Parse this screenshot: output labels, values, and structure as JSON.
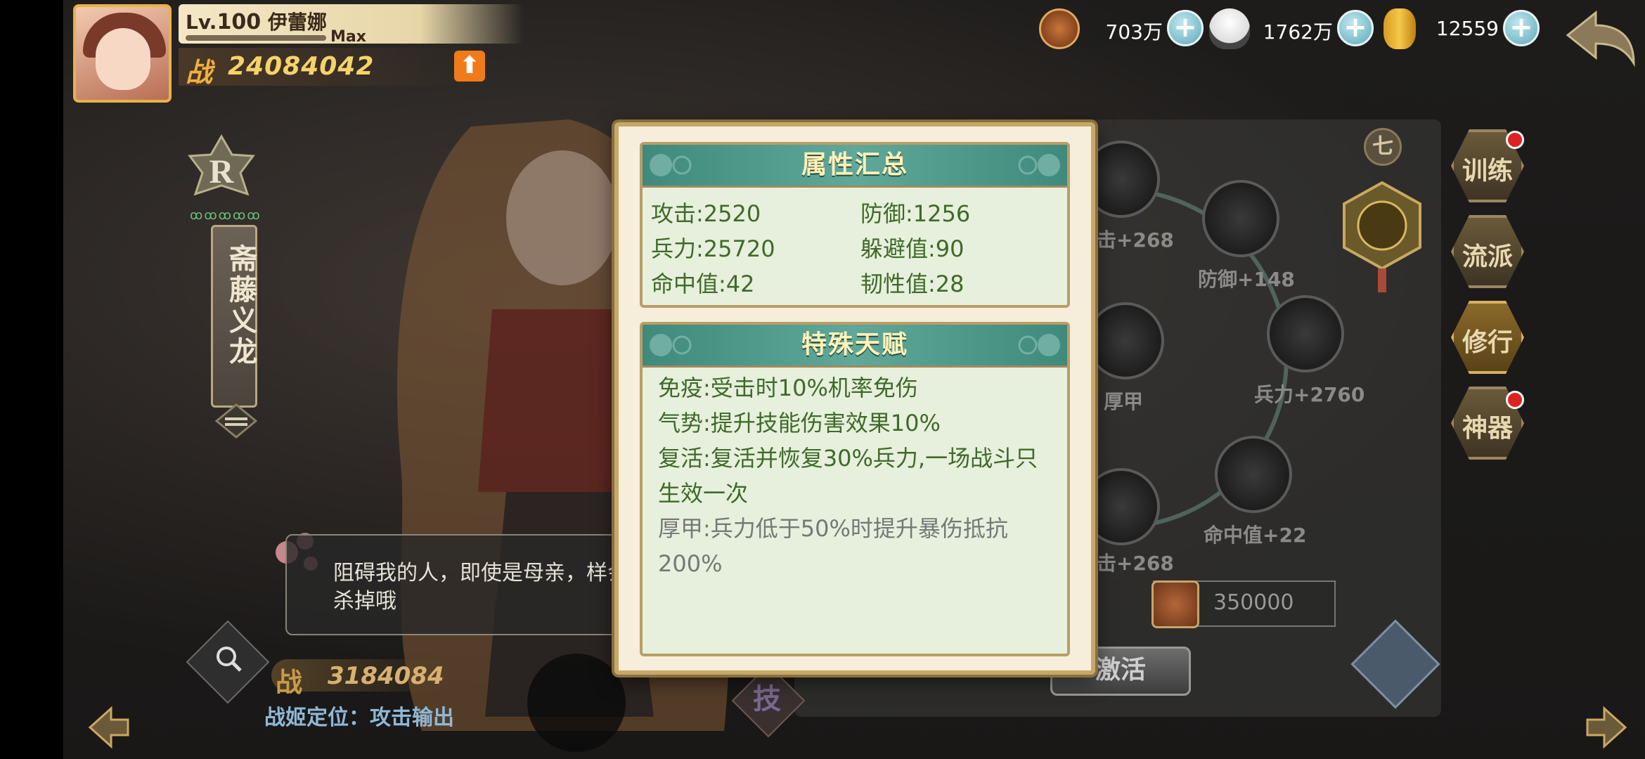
{
  "player": {
    "level_prefix": "Lv.",
    "level": "100",
    "name": "伊蕾娜",
    "xp_label": "Max",
    "power_label": "战",
    "power": "24084042"
  },
  "currencies": [
    {
      "icon": "copper-coin-icon",
      "amount": "703万"
    },
    {
      "icon": "rice-ball-icon",
      "amount": "1762万"
    },
    {
      "icon": "gold-koban-icon",
      "amount": "12559"
    }
  ],
  "hero": {
    "rank": "R",
    "name": "斋藤义龙",
    "quote": "阻碍我的人，即使是母亲，样会杀掉哦",
    "power_label": "战",
    "power": "3184084",
    "role": "战姬定位：攻击输出"
  },
  "attr_panel": {
    "title": "属性汇总",
    "stats": [
      {
        "label": "攻击:2520"
      },
      {
        "label": "防御:1256"
      },
      {
        "label": "兵力:25720"
      },
      {
        "label": "躲避值:90"
      },
      {
        "label": "命中值:42"
      },
      {
        "label": "韧性值:28"
      }
    ]
  },
  "talent_panel": {
    "title": "特殊天赋",
    "items": [
      {
        "text": "免疫:受击时10%机率免伤",
        "active": true
      },
      {
        "text": "气势:提升技能伤害效果10%",
        "active": true
      },
      {
        "text": "复活:复活并恢复30%兵力,一场战斗只生效一次",
        "active": true
      },
      {
        "text": "厚甲:兵力低于50%时提升暴伤抵抗200%",
        "active": false
      }
    ]
  },
  "skill_tree": {
    "tier": "七",
    "nodes": [
      {
        "label": "击+268"
      },
      {
        "label": "防御+148"
      },
      {
        "label": "厚甲"
      },
      {
        "label": "兵力+2760"
      },
      {
        "label": "击+268"
      },
      {
        "label": "命中值+22"
      }
    ],
    "cost": "350000",
    "activate_label": "激活"
  },
  "side_tabs": [
    {
      "label": "训练",
      "dot": true
    },
    {
      "label": "流派",
      "dot": false
    },
    {
      "label": "修行",
      "dot": false
    },
    {
      "label": "神器",
      "dot": true
    }
  ],
  "tech_label": "技"
}
